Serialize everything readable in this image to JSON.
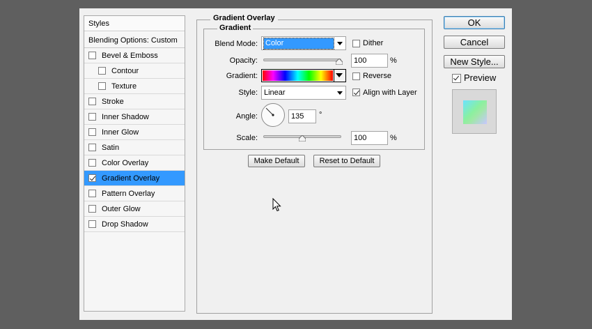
{
  "styles_panel": {
    "header": "Styles",
    "blending_options": "Blending Options: Custom",
    "items": [
      {
        "label": "Bevel & Emboss",
        "checked": false,
        "sub": false
      },
      {
        "label": "Contour",
        "checked": false,
        "sub": true
      },
      {
        "label": "Texture",
        "checked": false,
        "sub": true
      },
      {
        "label": "Stroke",
        "checked": false,
        "sub": false
      },
      {
        "label": "Inner Shadow",
        "checked": false,
        "sub": false
      },
      {
        "label": "Inner Glow",
        "checked": false,
        "sub": false
      },
      {
        "label": "Satin",
        "checked": false,
        "sub": false
      },
      {
        "label": "Color Overlay",
        "checked": false,
        "sub": false
      },
      {
        "label": "Gradient Overlay",
        "checked": true,
        "sub": false,
        "selected": true
      },
      {
        "label": "Pattern Overlay",
        "checked": false,
        "sub": false
      },
      {
        "label": "Outer Glow",
        "checked": false,
        "sub": false
      },
      {
        "label": "Drop Shadow",
        "checked": false,
        "sub": false
      }
    ]
  },
  "gradient_overlay": {
    "title": "Gradient Overlay",
    "group_title": "Gradient",
    "blend_mode_label": "Blend Mode:",
    "blend_mode_value": "Color",
    "dither_label": "Dither",
    "dither_checked": false,
    "opacity_label": "Opacity:",
    "opacity_value": "100",
    "opacity_level": 1.0,
    "percent": "%",
    "gradient_label": "Gradient:",
    "reverse_label": "Reverse",
    "reverse_checked": false,
    "style_label": "Style:",
    "style_value": "Linear",
    "align_label": "Align with Layer",
    "align_checked": true,
    "angle_label": "Angle:",
    "angle_value": "135",
    "angle_degrees": 135,
    "degree_symbol": "°",
    "scale_label": "Scale:",
    "scale_value": "100",
    "scale_level": 0.5,
    "make_default": "Make Default",
    "reset_default": "Reset to Default"
  },
  "buttons": {
    "ok": "OK",
    "cancel": "Cancel",
    "new_style": "New Style...",
    "preview_label": "Preview",
    "preview_checked": true
  },
  "colors": {
    "selected_bg": "#3399ff",
    "dialog_bg": "#f0f0f0",
    "backdrop": "#5f5f5f"
  }
}
